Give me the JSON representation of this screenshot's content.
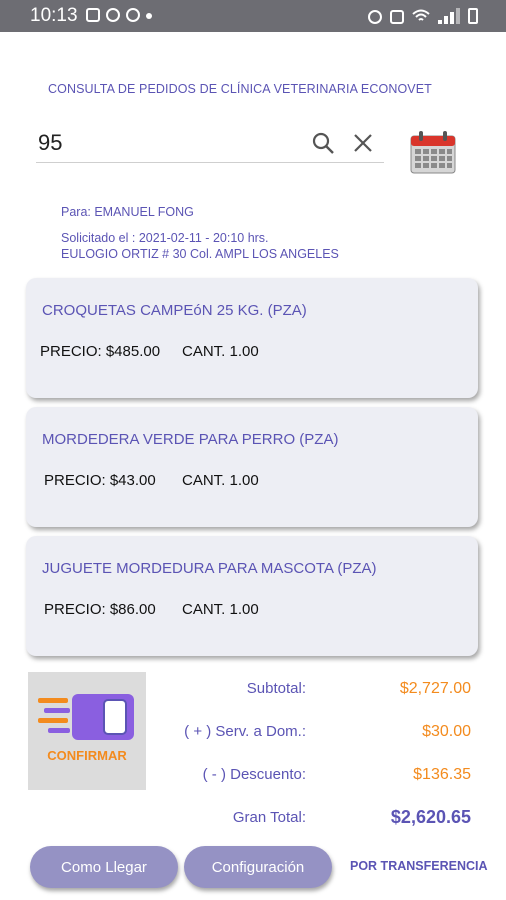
{
  "status_bar": {
    "time": "10:13"
  },
  "header": {
    "title": "CONSULTA DE PEDIDOS DE CLÍNICA VETERINARIA ECONOVET"
  },
  "search": {
    "value": "95"
  },
  "order": {
    "para": "Para: EMANUEL FONG",
    "solicitado": "Solicitado el :  2021-02-11 - 20:10 hrs.",
    "direccion": "EULOGIO ORTIZ # 30 Col. AMPL LOS ANGELES"
  },
  "items": [
    {
      "name": "CROQUETAS CAMPEóN 25 KG. (PZA)",
      "price": "PRECIO: $485.00",
      "qty": "CANT. 1.00"
    },
    {
      "name": "MORDEDERA VERDE PARA PERRO (PZA)",
      "price": "PRECIO: $43.00",
      "qty": "CANT. 1.00"
    },
    {
      "name": "JUGUETE MORDEDURA PARA MASCOTA (PZA)",
      "price": "PRECIO: $86.00",
      "qty": "CANT. 1.00"
    }
  ],
  "confirm": {
    "label": "CONFIRMAR"
  },
  "totals": {
    "subtotal_label": "Subtotal:",
    "subtotal_value": "$2,727.00",
    "serv_label": "( + ) Serv. a Dom.:",
    "serv_value": "$30.00",
    "desc_label": "( - ) Descuento:",
    "desc_value": "$136.35",
    "grand_label": "Gran Total:",
    "grand_value": "$2,620.65"
  },
  "buttons": {
    "como_llegar": "Como Llegar",
    "configuracion": "Configuración",
    "transferencia": "POR TRANSFERENCIA"
  },
  "colors": {
    "accent": "#5b54b4",
    "orange": "#f38b1e",
    "button": "#9592c4",
    "card": "#edeef4"
  },
  "icons": [
    "image-icon",
    "whatsapp-icon",
    "blocked-icon",
    "alarm-icon",
    "mute-icon",
    "wifi-icon",
    "signal-icon",
    "battery-icon",
    "search-icon",
    "close-icon",
    "calendar-icon",
    "card-payment-icon"
  ]
}
